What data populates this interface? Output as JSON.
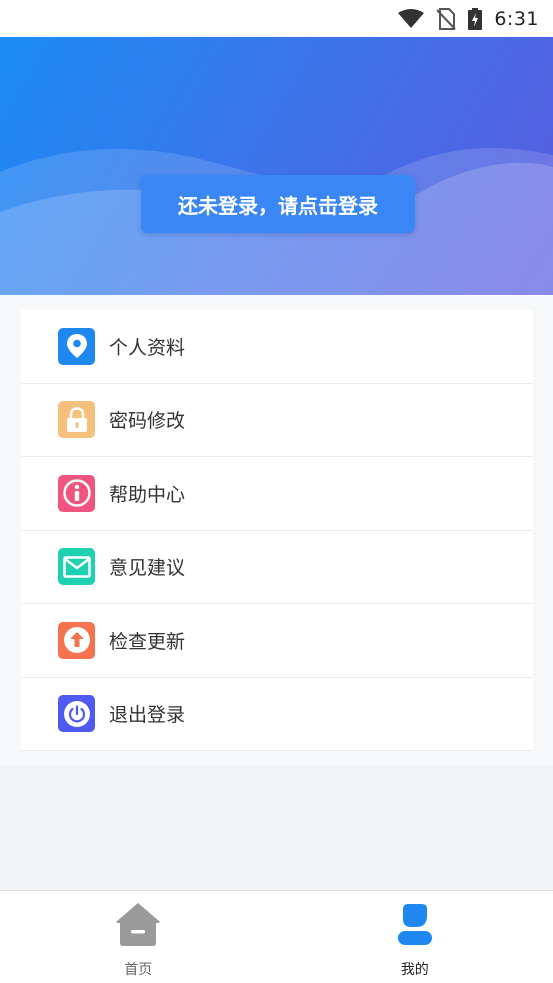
{
  "status_bar": {
    "time": "6:31"
  },
  "header": {
    "login_label": "还未登录，请点击登录"
  },
  "menu": {
    "items": [
      {
        "label": "个人资料",
        "icon": "location-pin-icon",
        "color": "#1e88f0"
      },
      {
        "label": "密码修改",
        "icon": "lock-icon",
        "color": "#f5c07c"
      },
      {
        "label": "帮助中心",
        "icon": "info-icon",
        "color": "#f0557f"
      },
      {
        "label": "意见建议",
        "icon": "mail-icon",
        "color": "#1fd1b0"
      },
      {
        "label": "检查更新",
        "icon": "upload-arrow-icon",
        "color": "#f5724e"
      },
      {
        "label": "退出登录",
        "icon": "power-icon",
        "color": "#4e5af0"
      }
    ]
  },
  "bottom_nav": {
    "tabs": [
      {
        "label": "首页",
        "icon": "home-icon",
        "active": false
      },
      {
        "label": "我的",
        "icon": "user-icon",
        "active": true
      }
    ],
    "active_color": "#1e88f0",
    "inactive_color": "#9a9a9a"
  }
}
